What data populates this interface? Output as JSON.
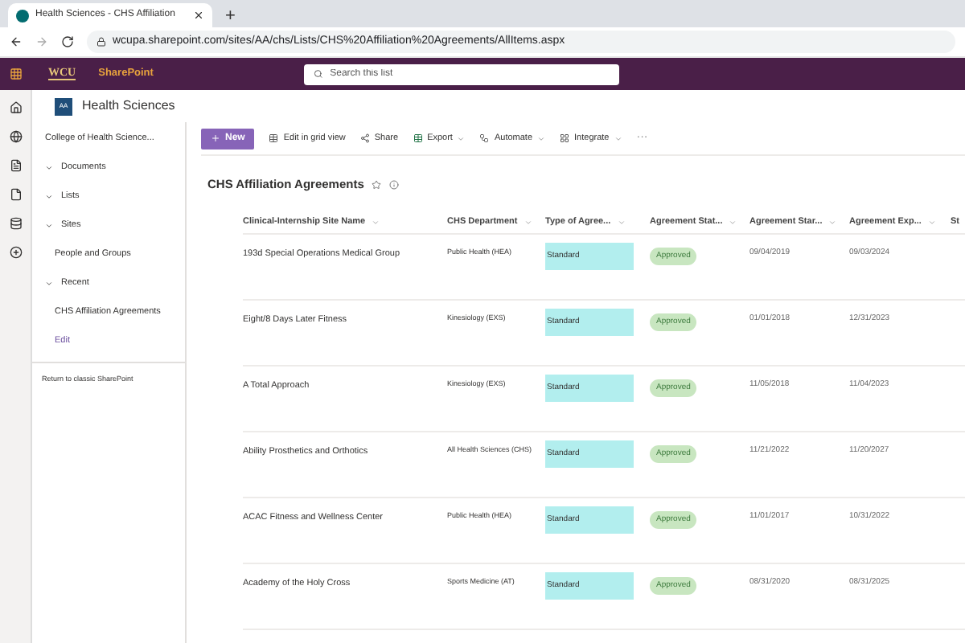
{
  "browser": {
    "tab_title": "Health Sciences - CHS Affiliation",
    "new_tab": "+",
    "url": "wcupa.sharepoint.com/sites/AA/chs/Lists/CHS%20Affiliation%20Agreements/AllItems.aspx"
  },
  "suite_bar": {
    "logo": "WCU",
    "app": "SharePoint",
    "search": {
      "placeholder": "Search this list"
    }
  },
  "site": {
    "badge": "AA",
    "title": "Health Sciences"
  },
  "nav": {
    "items": [
      {
        "label": "College of Health Science...",
        "kind": "link"
      },
      {
        "label": "Documents",
        "kind": "group"
      },
      {
        "label": "Lists",
        "kind": "group"
      },
      {
        "label": "Sites",
        "kind": "group"
      },
      {
        "label": "People and Groups",
        "kind": "link"
      },
      {
        "label": "Recent",
        "kind": "group"
      },
      {
        "label": "CHS Affiliation Agreements",
        "kind": "link"
      },
      {
        "label": "Edit",
        "kind": "edit"
      }
    ],
    "footer": "Return to classic SharePoint"
  },
  "commands": [
    {
      "label": "New",
      "kind": "primary"
    },
    {
      "label": "Edit in grid view",
      "kind": "grid"
    },
    {
      "label": "Share",
      "kind": "share"
    },
    {
      "label": "Export",
      "kind": "excel"
    },
    {
      "label": "Automate",
      "kind": "automate"
    },
    {
      "label": "Integrate",
      "kind": "integrate"
    },
    {
      "label": "···",
      "kind": "more"
    }
  ],
  "list_title": "CHS Affiliation Agreements",
  "table": {
    "columns": [
      "Clinical-Internship Site Name",
      "CHS Department",
      "Type of Agree...",
      "Agreement Stat...",
      "Agreement Star...",
      "Agreement Exp...",
      "St"
    ],
    "rows": [
      {
        "name": "193d Special Operations Medical Group",
        "department": "Public Health (HEA)",
        "type": "Standard",
        "status": "Approved",
        "start": "09/04/2019",
        "expiry": "09/03/2024"
      },
      {
        "name": "Eight/8 Days Later Fitness",
        "department": "Kinesiology (EXS)",
        "type": "Standard",
        "status": "Approved",
        "start": "01/01/2018",
        "expiry": "12/31/2023"
      },
      {
        "name": "A Total Approach",
        "department": "Kinesiology (EXS)",
        "type": "Standard",
        "status": "Approved",
        "start": "11/05/2018",
        "expiry": "11/04/2023"
      },
      {
        "name": "Ability Prosthetics and Orthotics",
        "department": "All Health Sciences (CHS)",
        "type": "Standard",
        "status": "Approved",
        "start": "11/21/2022",
        "expiry": "11/20/2027"
      },
      {
        "name": "ACAC Fitness and Wellness Center",
        "department": "Public Health (HEA)",
        "type": "Standard",
        "status": "Approved",
        "start": "11/01/2017",
        "expiry": "10/31/2022"
      },
      {
        "name": "Academy of the Holy Cross",
        "department": "Sports Medicine (AT)",
        "type": "Standard",
        "status": "Approved",
        "start": "08/31/2020",
        "expiry": "08/31/2025"
      }
    ]
  }
}
